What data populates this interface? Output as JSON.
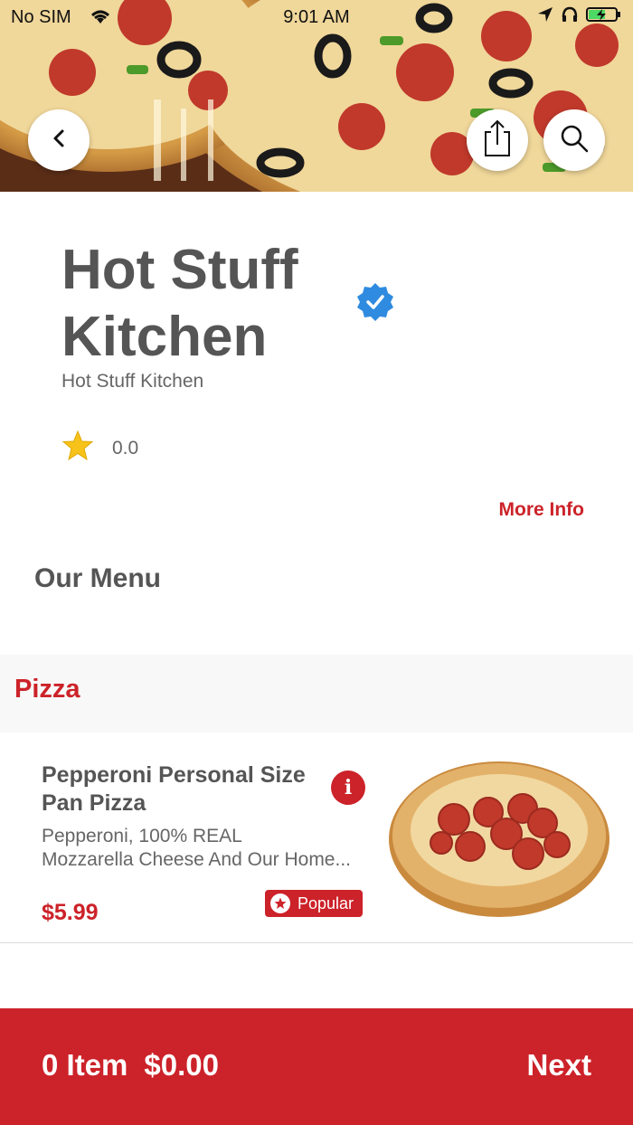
{
  "status_bar": {
    "carrier": "No SIM",
    "time": "9:01 AM"
  },
  "restaurant": {
    "name": "Hot Stuff Kitchen",
    "subtitle": "Hot Stuff Kitchen",
    "rating": "0.0",
    "more_info_label": "More Info"
  },
  "menu": {
    "heading": "Our Menu",
    "categories": [
      {
        "name": "Pizza",
        "items": [
          {
            "name": "Pepperoni Personal Size Pan Pizza",
            "description_line1": "Pepperoni, 100% REAL",
            "description_line2": "Mozzarella Cheese And Our Home...",
            "price": "$5.99",
            "badge": "Popular"
          }
        ]
      }
    ]
  },
  "cart": {
    "item_count": "0 Item",
    "total": "$0.00",
    "next_label": "Next"
  },
  "colors": {
    "accent": "#cc2229",
    "verified": "#2f8be0",
    "text": "#555555"
  },
  "icons": [
    "back-icon",
    "share-icon",
    "search-icon",
    "verified-badge-icon",
    "star-icon",
    "info-icon",
    "popular-star-icon"
  ]
}
